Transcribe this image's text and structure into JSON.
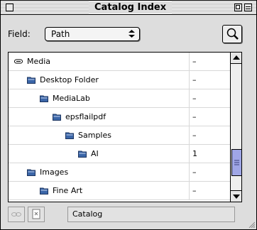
{
  "window": {
    "title": "Catalog Index"
  },
  "field": {
    "label": "Field:",
    "selected": "Path"
  },
  "rows": [
    {
      "name": "Media",
      "value": "–",
      "icon": "disk-icon"
    },
    {
      "name": "Desktop Folder",
      "value": "–",
      "icon": "folder-icon"
    },
    {
      "name": "MediaLab",
      "value": "–",
      "icon": "folder-icon"
    },
    {
      "name": "epsflailpdf",
      "value": "–",
      "icon": "folder-icon"
    },
    {
      "name": "Samples",
      "value": "–",
      "icon": "folder-icon"
    },
    {
      "name": "AI",
      "value": "1",
      "icon": "folder-icon"
    },
    {
      "name": "Images",
      "value": "–",
      "icon": "folder-icon"
    },
    {
      "name": "Fine Art",
      "value": "–",
      "icon": "folder-icon"
    }
  ],
  "bottom": {
    "field_label": "Catalog"
  },
  "colors": {
    "scroll_thumb": "#9fa6e6",
    "folder": "#3b66a8"
  }
}
